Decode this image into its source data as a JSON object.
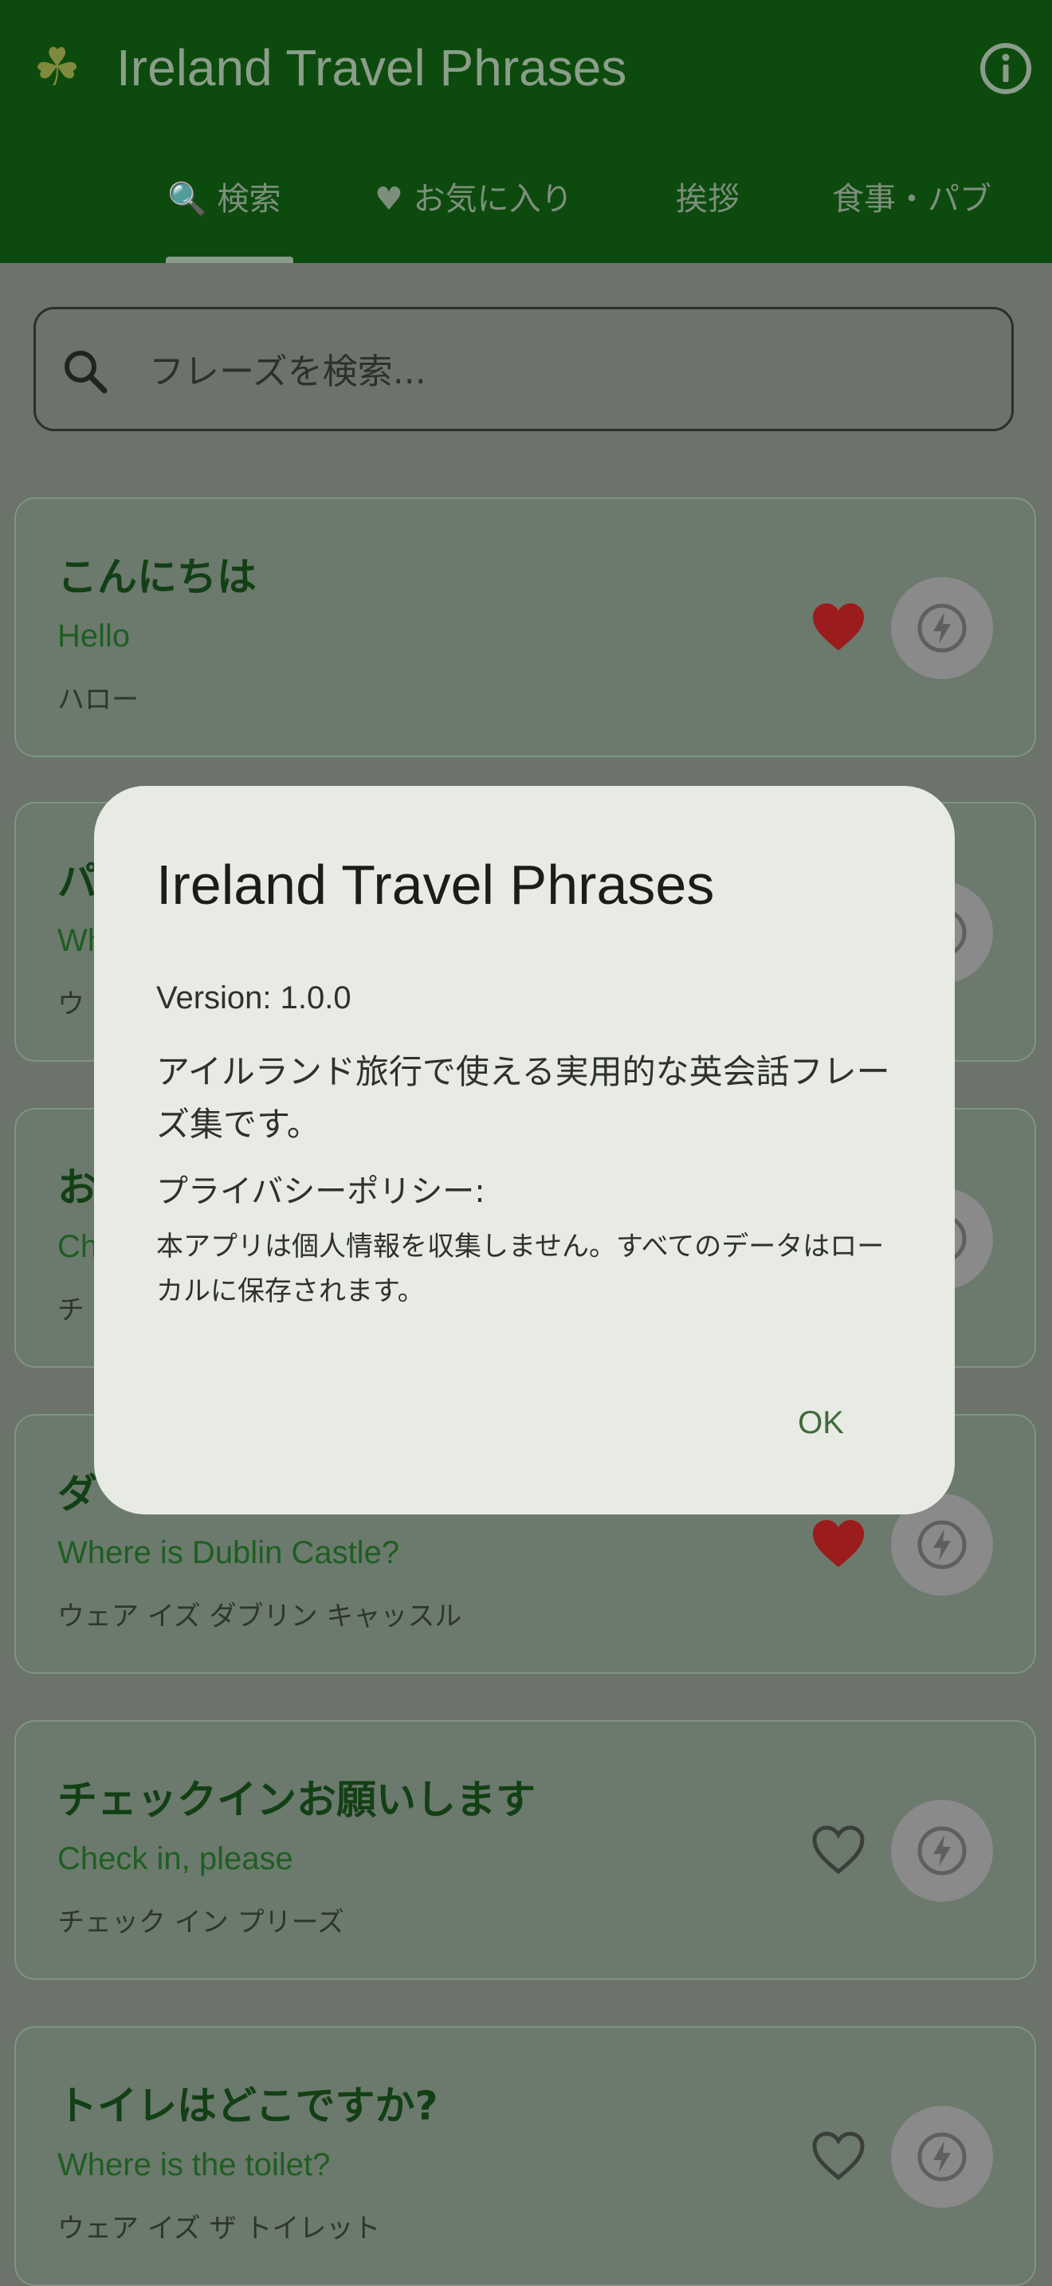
{
  "app": {
    "title": "Ireland Travel Phrases",
    "logo_icon": "shamrock-icon"
  },
  "tabs": [
    {
      "label": "🔍 検索",
      "selected": true
    },
    {
      "label": "♥ お気に入り",
      "selected": false
    },
    {
      "label": "挨拶",
      "selected": false
    },
    {
      "label": "食事・パブ",
      "selected": false
    }
  ],
  "search": {
    "placeholder": "フレーズを検索..."
  },
  "phrases": [
    {
      "ja": "こんにちは",
      "en": "Hello",
      "kana": "ハロー",
      "favorite": true
    },
    {
      "ja": "パ",
      "en": "Wh",
      "kana": "ウ",
      "favorite": false
    },
    {
      "ja": "お",
      "en": "Ch",
      "kana": "チ",
      "favorite": false
    },
    {
      "ja": "ダ",
      "en": "Where is Dublin Castle?",
      "kana": "ウェア イズ ダブリン キャッスル",
      "favorite": true
    },
    {
      "ja": "チェックインお願いします",
      "en": "Check in, please",
      "kana": "チェック イン プリーズ",
      "favorite": false
    },
    {
      "ja": "トイレはどこですか?",
      "en": "Where is the toilet?",
      "kana": "ウェア イズ ザ トイレット",
      "favorite": false
    }
  ],
  "dialog": {
    "title": "Ireland Travel Phrases",
    "version": "Version: 1.0.0",
    "description": "アイルランド旅行で使える実用的な英会話フレーズ集です。",
    "privacy_title": "プライバシーポリシー:",
    "privacy_text": "本アプリは個人情報を収集しません。すべてのデータはローカルに保存されます。",
    "ok_label": "OK"
  },
  "colors": {
    "appbar": "#0d4a0e",
    "favorite_active": "#9b1c1c",
    "accent_text": "#1f5e22",
    "dialog_bg": "#e8ebe4"
  }
}
